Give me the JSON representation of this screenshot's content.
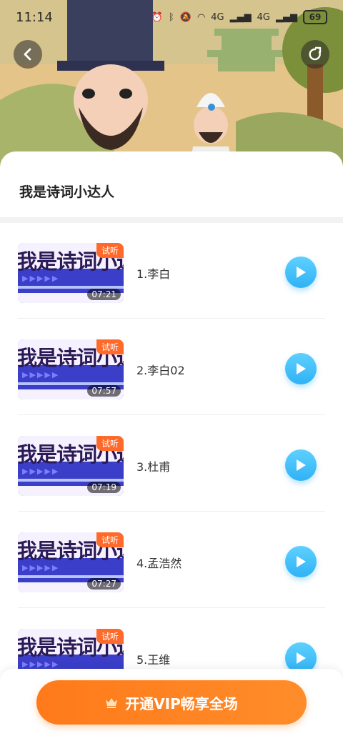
{
  "status": {
    "time": "11:14",
    "network_1": "4G",
    "network_2": "4G",
    "battery": "69"
  },
  "page": {
    "title": "我是诗词小达人",
    "trial_badge": "试听",
    "thumb_text": "我是诗词小达人"
  },
  "lessons": [
    {
      "label": "1.李白",
      "duration": "07:21"
    },
    {
      "label": "2.李白02",
      "duration": "07:57"
    },
    {
      "label": "3.杜甫",
      "duration": "07:19"
    },
    {
      "label": "4.孟浩然",
      "duration": "07:27"
    },
    {
      "label": "5.王维",
      "duration": ""
    }
  ],
  "vip": {
    "button_label": "开通VIP畅享全场",
    "icon": "crown-icon"
  },
  "colors": {
    "accent_orange": "#ff7a1a",
    "play_blue": "#2fb2f5",
    "thumb_blue": "#3a3ec8"
  }
}
